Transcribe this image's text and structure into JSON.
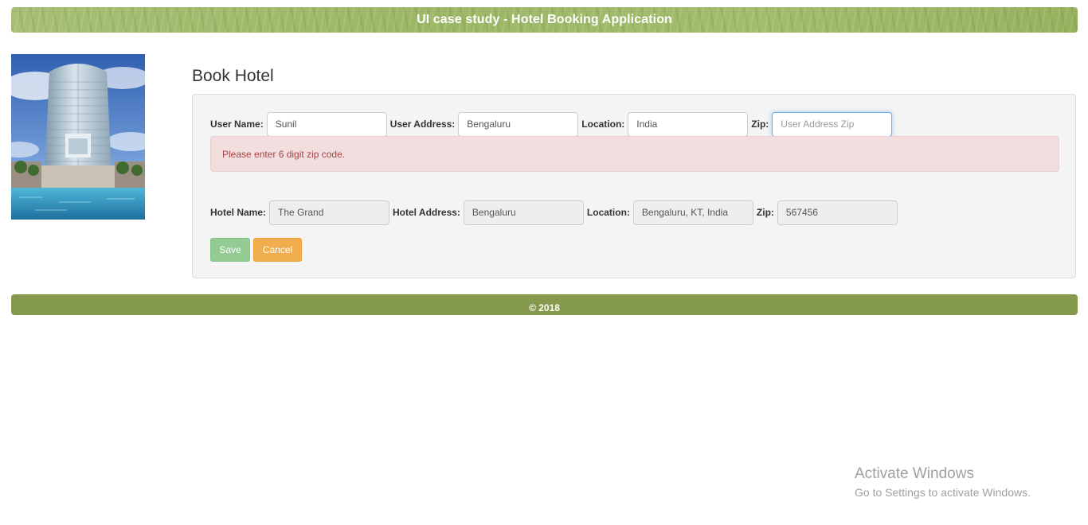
{
  "header": {
    "title": "UI case study - Hotel Booking Application"
  },
  "page": {
    "title": "Book Hotel"
  },
  "user_form": {
    "user_name_label": "User Name:",
    "user_name_value": "Sunil",
    "user_address_label": "User Address:",
    "user_address_value": "Bengaluru",
    "location_label": "Location:",
    "location_value": "India",
    "zip_label": "Zip:",
    "zip_value": "",
    "zip_placeholder": "User Address Zip"
  },
  "alert": {
    "message": "Please enter 6 digit zip code."
  },
  "hotel_form": {
    "hotel_name_label": "Hotel Name:",
    "hotel_name_value": "The Grand",
    "hotel_address_label": "Hotel Address:",
    "hotel_address_value": "Bengaluru",
    "location_label": "Location:",
    "location_value": "Bengaluru, KT, India",
    "zip_label": "Zip:",
    "zip_value": "567456"
  },
  "buttons": {
    "save_label": "Save",
    "cancel_label": "Cancel"
  },
  "footer": {
    "text": "© 2018"
  },
  "watermark": {
    "title": "Activate Windows",
    "subtitle": "Go to Settings to activate Windows."
  },
  "colors": {
    "header_green": "#9cb866",
    "footer_green": "#84994c",
    "save_button": "#93cb92",
    "cancel_button": "#f0ad4e",
    "alert_background": "#f2dede",
    "alert_text": "#a94442"
  }
}
